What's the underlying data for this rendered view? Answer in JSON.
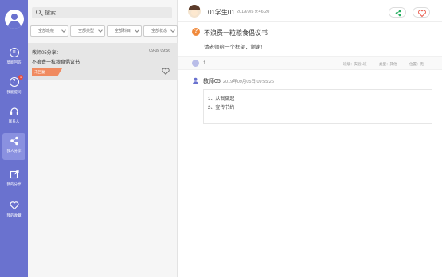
{
  "sidebar": {
    "items": [
      {
        "label": "莫能回答",
        "icon": "chat-icon"
      },
      {
        "label": "我能提问",
        "icon": "question-icon",
        "badge": "1"
      },
      {
        "label": "联系人",
        "icon": "headset-icon"
      },
      {
        "label": "我人分享",
        "icon": "share-icon",
        "active": true
      },
      {
        "label": "我的分享",
        "icon": "export-icon"
      },
      {
        "label": "我的收藏",
        "icon": "heart-icon"
      }
    ]
  },
  "list": {
    "search_value": "搜索",
    "filters": [
      "全部班级",
      "全部类型",
      "全部科目",
      "全部状态"
    ],
    "items": [
      {
        "author": "教师05分享：",
        "time": "09-05 09:56",
        "title": "不浪费一粒粮食倡议书",
        "tag": "未回复"
      }
    ]
  },
  "detail": {
    "student_name": "01学生01",
    "student_time": "2019/9/5 9:46:20",
    "question_title": "不浪费一粒粮食倡议书",
    "question_desc": "请老师给一个框架，谢谢!",
    "reply_count": "1",
    "meta": {
      "class": "班级：实验1班",
      "type": "类型：其他",
      "position": "位置：无"
    },
    "reply": {
      "author": "教师05",
      "time": "2019年09月05日 09:55:26",
      "lines": [
        "1、从我做起",
        "2、宣传节约"
      ]
    }
  },
  "colors": {
    "nav_bg": "#6a72cf",
    "accent_orange": "#f08a3c",
    "tag_bg": "#f08a60",
    "share_green": "#27ae60",
    "like_red": "#e74c3c"
  }
}
